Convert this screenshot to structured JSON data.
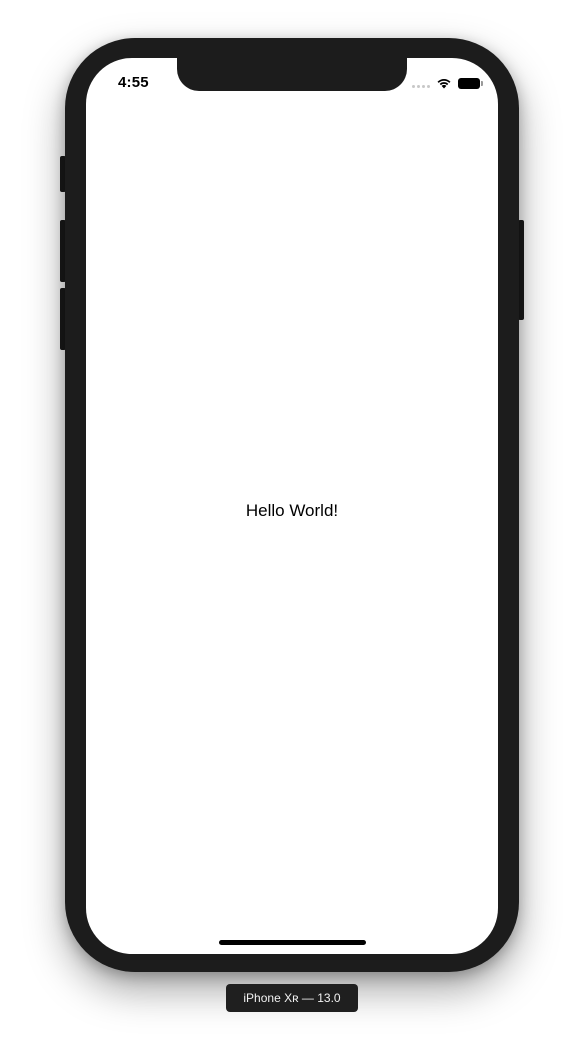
{
  "device": {
    "label": "iPhone Xʀ — 13.0",
    "frame_color": "#1c1c1c"
  },
  "status_bar": {
    "time": "4:55",
    "icons": [
      "signal-dots-icon",
      "wifi-icon",
      "battery-icon"
    ]
  },
  "app": {
    "text": "Hello World!",
    "background": "#ffffff"
  }
}
